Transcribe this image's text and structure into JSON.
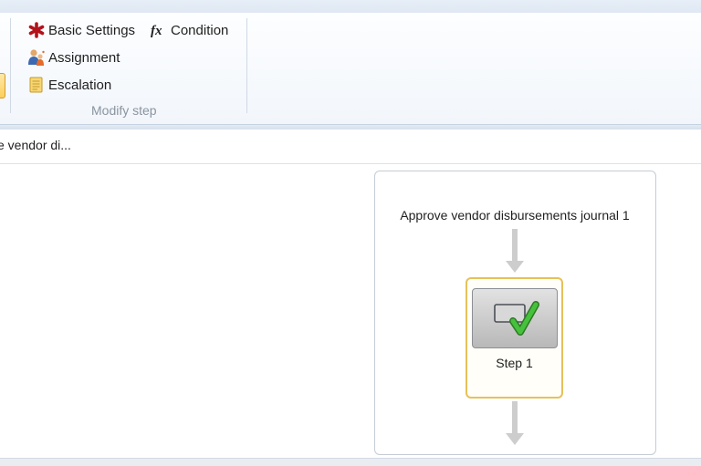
{
  "ribbon": {
    "buttons": {
      "basic_settings": "Basic Settings",
      "condition": "Condition",
      "assignment": "Assignment",
      "escalation": "Escalation"
    },
    "group_label": "Modify step"
  },
  "address": {
    "path_text": "e vendor di..."
  },
  "workflow": {
    "title": "Approve vendor disbursements journal 1",
    "step": {
      "label": "Step 1",
      "icon": "approval-step-icon"
    }
  },
  "colors": {
    "accent_red": "#b3121b",
    "step_border": "#e6c15a",
    "check_green": "#3fb53a"
  }
}
